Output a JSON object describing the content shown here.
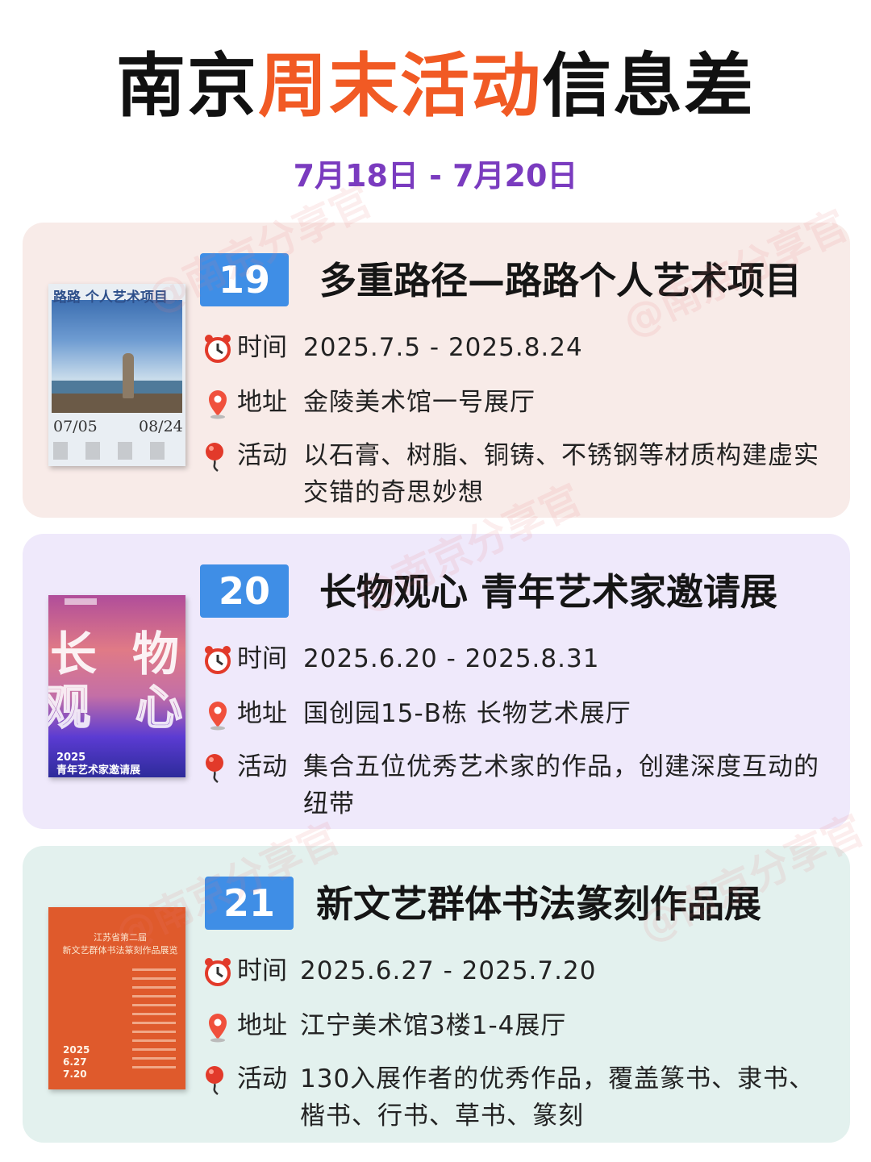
{
  "header": {
    "title_prefix": "南京",
    "title_highlight": "周末活动",
    "title_suffix": "信息差",
    "date_range": "7月18日 - 7月20日"
  },
  "colors": {
    "highlight": "#f15a24",
    "date": "#7a3bbf",
    "badge": "#3f8ee6",
    "card_1_bg": "#f8ebe8",
    "card_2_bg": "#efe9fb",
    "card_3_bg": "#e3f1ee"
  },
  "labels": {
    "time": "时间",
    "address": "地址",
    "activity": "活动"
  },
  "icons": {
    "time": "alarm-clock-icon",
    "address": "map-pin-icon",
    "activity": "balloon-pin-icon"
  },
  "events": [
    {
      "number": "19",
      "title": "多重路径—路路个人艺术项目",
      "time": "2025.7.5 - 2025.8.24",
      "address": "金陵美术馆一号展厅",
      "activity": "以石膏、树脂、铜铸、不锈钢等材质构建虚实交错的奇思妙想",
      "poster": {
        "title": "路路 个人艺术项目",
        "date_start": "07/05",
        "date_end": "08/24"
      }
    },
    {
      "number": "20",
      "title": "长物观心 青年艺术家邀请展",
      "time": "2025.6.20 - 2025.8.31",
      "address": "国创园15-B栋 长物艺术展厅",
      "activity": "集合五位优秀艺术家的作品，创建深度互动的纽带",
      "poster": {
        "char_1": "长",
        "char_2": "物",
        "char_3": "观",
        "char_4": "心",
        "year": "2025",
        "subtitle": "青年艺术家邀请展"
      }
    },
    {
      "number": "21",
      "title": "新文艺群体书法篆刻作品展",
      "time": "2025.6.27 - 2025.7.20",
      "address": "江宁美术馆3楼1-4展厅",
      "activity": "130入展作者的优秀作品，覆盖篆书、隶书、楷书、行书、草书、篆刻",
      "poster": {
        "title_line_1": "江苏省第二届",
        "title_line_2": "新文艺群体书法篆刻作品展览",
        "year": "2025",
        "date_1": "6.27",
        "date_2": "7.20"
      }
    }
  ],
  "watermark": "@南京分享官"
}
